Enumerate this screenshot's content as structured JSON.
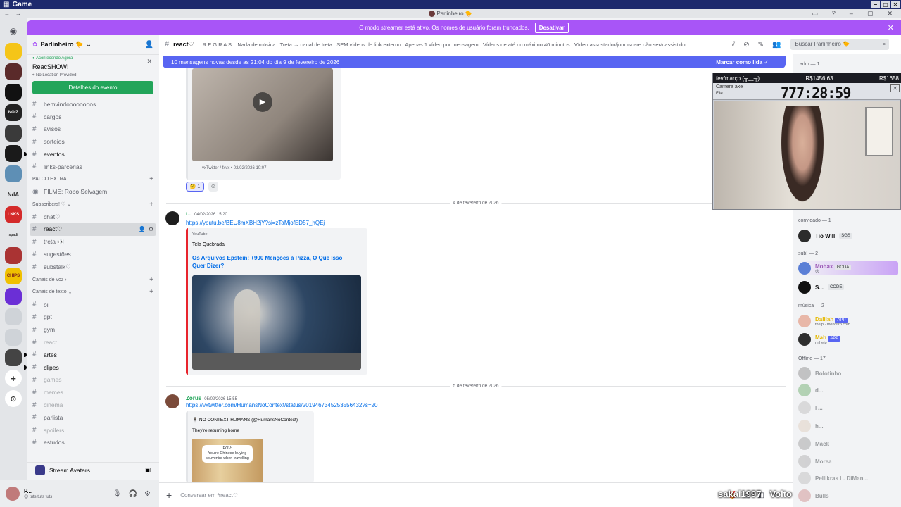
{
  "os_window": {
    "title": "Game"
  },
  "app_title": {
    "server_name": "Parlinheiro 🐤"
  },
  "streamer_banner": {
    "text": "O modo streamer está ativo. Os nomes de usuário foram truncados.",
    "button": "Desativar"
  },
  "server": {
    "name": "Parlinheiro 🐤",
    "event": {
      "status": "Acontecendo Agora",
      "title": "ReacSHOW!",
      "location": "No Location Provided",
      "button": "Detalhes do evento"
    },
    "top_channels": [
      {
        "name": "bemvindoooooooos"
      },
      {
        "name": "cargos"
      },
      {
        "name": "avisos"
      },
      {
        "name": "sorteios"
      },
      {
        "name": "eventos"
      },
      {
        "name": "links-parcerias"
      }
    ],
    "palco_category": "PALCO EXTRA",
    "stage_channel": "FILME: Robo Selvagem",
    "subscribers_category": "Subscribers! ♡",
    "sub_channels": [
      {
        "name": "chat♡"
      },
      {
        "name": "react♡"
      },
      {
        "name": "treta 👀"
      },
      {
        "name": "sugestões"
      },
      {
        "name": "substalk♡"
      }
    ],
    "voice_category": "Canais de voz",
    "text_category": "Canais de texto",
    "text_channels": [
      {
        "name": "oi"
      },
      {
        "name": "gpt"
      },
      {
        "name": "gym"
      },
      {
        "name": "react"
      },
      {
        "name": "artes"
      },
      {
        "name": "clipes"
      },
      {
        "name": "games"
      },
      {
        "name": "memes"
      },
      {
        "name": "cinema"
      },
      {
        "name": "parlista"
      },
      {
        "name": "spoilers"
      },
      {
        "name": "estudos"
      }
    ]
  },
  "stream_avatars": "Stream Avatars",
  "user_panel": {
    "name": "P...",
    "status": "tuts tuts tuts"
  },
  "chat_header": {
    "channel": "react♡",
    "topic": "R E G R A S. . Nada de música . Treta → canal de treta . SEM vídeos de link externo . Apenas 1 vídeo por mensagem . Vídeos de até no máximo 40 minutos . Vídeo assustador/jumpscare não será assistido . ...",
    "search_placeholder": "Buscar Parlinheiro 🐤"
  },
  "new_messages_bar": {
    "text": "10 mensagens novas desde as 21:04 do dia 9 de fevereiro de 2026",
    "mark_read": "Marcar como lida"
  },
  "messages": {
    "first_embed_footer": "vxTwitter / fxvx • 02/02/2026 10:07",
    "reaction_count": "1",
    "divider1": "4 de fevereiro de 2026",
    "msg2": {
      "author": "t...",
      "time": "04/02/2026 15:20",
      "link": "https://youtu.be/BEU8mXBH2jY?si=zTaMjofED57_hQEj",
      "provider": "YouTube",
      "channel": "Tela Quebrada",
      "title": "Os Arquivos Epstein: +900 Menções à Pizza, O Que Isso Quer Dizer?"
    },
    "divider2": "5 de fevereiro de 2026",
    "msg3": {
      "author": "Zorus",
      "time": "05/02/2026 15:55",
      "link": "https://vxtwitter.com/HumansNoContext/status/2019467345253556432?s=20",
      "embed_author": "NO CONTEXT HUMANS (@HumansNoContext)",
      "embed_text": "They're returning home",
      "image_caption_1": "POV:",
      "image_caption_2": "You're Chinese buying souvenirs when travelling"
    }
  },
  "composer": {
    "placeholder": "Conversar em #react♡"
  },
  "webcam_overlay": {
    "label_left": "fev/março (╥﹏╥)",
    "money1": "R$1456.63",
    "money2": "R$1658",
    "window_title": "Camera axe",
    "file_label": "File",
    "timer": "777:28:59"
  },
  "members": {
    "adm_header": "adm — 1",
    "convidado_header": "convidado — 1",
    "convidado": [
      {
        "name": "Tio Will",
        "tag": "SGS",
        "color": "#060607"
      }
    ],
    "sub_header": "sub! — 2",
    "sub": [
      {
        "name": "Mohax",
        "tag": "GODA",
        "color": "#9b59b6",
        "sub": "😢"
      },
      {
        "name": "S...",
        "tag": "CODE",
        "color": "#060607"
      }
    ],
    "musica_header": "música — 2",
    "musica": [
      {
        "name": "Dalilah",
        "tag": "APP",
        "color": "#e6b800",
        "sub": "fhelp · mekotiro.com"
      },
      {
        "name": "Mah",
        "tag": "APP",
        "color": "#e6b800",
        "sub": "m!help"
      }
    ],
    "offline_header": "Offline — 17",
    "offline": [
      {
        "name": "Bolotinho"
      },
      {
        "name": "d..."
      },
      {
        "name": "F..."
      },
      {
        "name": "h..."
      },
      {
        "name": "Mack"
      },
      {
        "name": "Morea"
      },
      {
        "name": "Pellikras L. DiMan..."
      },
      {
        "name": "Bulls"
      }
    ]
  },
  "watermark": {
    "left": "sakai1997",
    "right": "Volto"
  },
  "colors": {
    "accent": "#5865f2",
    "streamer": "#a855f7",
    "event_green": "#23a55a"
  }
}
